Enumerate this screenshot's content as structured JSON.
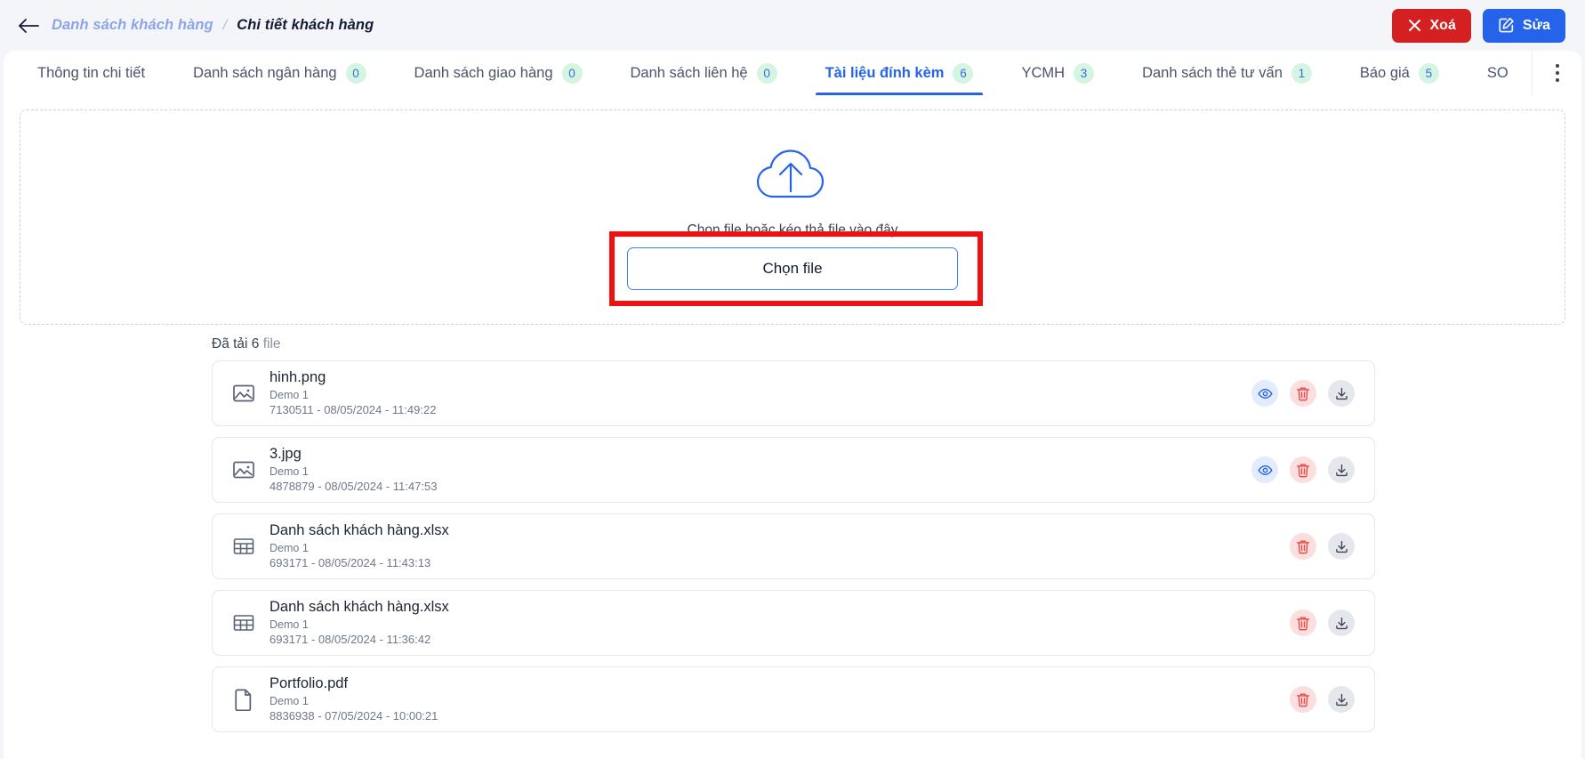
{
  "topbar": {
    "back_icon": "arrow-left-icon",
    "breadcrumb": {
      "parent": "Danh sách khách hàng",
      "separator": "/",
      "current": "Chi tiết khách hàng"
    },
    "delete_label": "Xoá",
    "edit_label": "Sửa",
    "delete_color": "#d42020",
    "edit_color": "#2563eb"
  },
  "tabs": {
    "items": [
      {
        "label": "Thông tin chi tiết",
        "badge": null,
        "active": false
      },
      {
        "label": "Danh sách ngân hàng",
        "badge": "0",
        "active": false
      },
      {
        "label": "Danh sách giao hàng",
        "badge": "0",
        "active": false
      },
      {
        "label": "Danh sách liên hệ",
        "badge": "0",
        "active": false
      },
      {
        "label": "Tài liệu đính kèm",
        "badge": "6",
        "active": true
      },
      {
        "label": "YCMH",
        "badge": "3",
        "active": false
      },
      {
        "label": "Danh sách thẻ tư vấn",
        "badge": "1",
        "active": false
      },
      {
        "label": "Báo giá",
        "badge": "5",
        "active": false
      },
      {
        "label": "SO",
        "badge": null,
        "active": false
      }
    ],
    "more_icon": "kebab-menu-icon",
    "active_color": "#2563eb",
    "badge_bg": "#d3f5e2",
    "badge_text_color": "#3d6ae0"
  },
  "upload": {
    "cloud_icon": "cloud-upload-icon",
    "hint": "Chọn file hoặc kéo thả file vào đây",
    "button_label": "Chọn file",
    "highlight_color": "#ee1111"
  },
  "files": {
    "count_prefix": "Đã tải 6",
    "count_suffix": "file",
    "items": [
      {
        "name": "hinh.png",
        "owner": "Demo 1",
        "detail": "7130511 - 08/05/2024 - 11:49:22",
        "icon": "image-icon",
        "has_view": true
      },
      {
        "name": "3.jpg",
        "owner": "Demo 1",
        "detail": "4878879 - 08/05/2024 - 11:47:53",
        "icon": "image-icon",
        "has_view": true
      },
      {
        "name": "Danh sách khách hàng.xlsx",
        "owner": "Demo 1",
        "detail": "693171 - 08/05/2024 - 11:43:13",
        "icon": "spreadsheet-icon",
        "has_view": false
      },
      {
        "name": "Danh sách khách hàng.xlsx",
        "owner": "Demo 1",
        "detail": "693171 - 08/05/2024 - 11:36:42",
        "icon": "spreadsheet-icon",
        "has_view": false
      },
      {
        "name": "Portfolio.pdf",
        "owner": "Demo 1",
        "detail": "8836938 - 07/05/2024 - 10:00:21",
        "icon": "document-icon",
        "has_view": false
      }
    ],
    "action_labels": {
      "view": "view-icon",
      "delete": "trash-icon",
      "download": "download-icon"
    }
  }
}
